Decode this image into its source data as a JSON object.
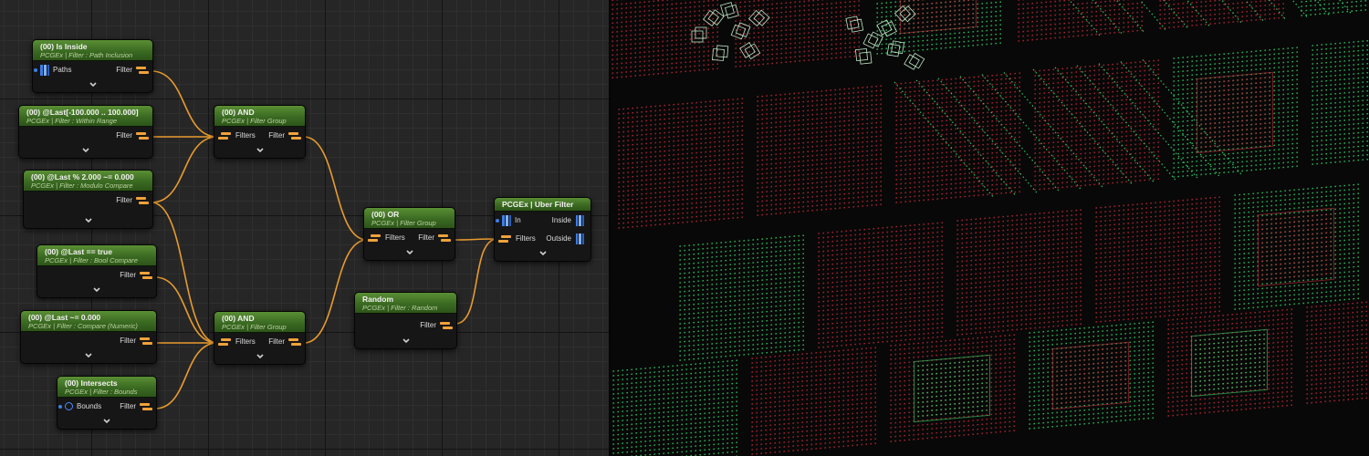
{
  "graph_editor": {
    "nodes": [
      {
        "id": "inside",
        "title": "(00) Is Inside",
        "subtitle": "PCGEx | Filter : Path Inclusion",
        "pins": [
          {
            "label": "Paths",
            "type": "points-in"
          },
          {
            "label": "Filter",
            "type": "filter-out"
          }
        ]
      },
      {
        "id": "range",
        "title": "(00) @Last[-100.000 .. 100.000]",
        "subtitle": "PCGEx | Filter : Within Range",
        "pins": [
          {
            "label": "Filter",
            "type": "filter-out"
          }
        ]
      },
      {
        "id": "modulo",
        "title": "(00) @Last % 2.000  ~=  0.000",
        "subtitle": "PCGEx | Filter : Modulo Compare",
        "pins": [
          {
            "label": "Filter",
            "type": "filter-out"
          }
        ]
      },
      {
        "id": "bool",
        "title": "(00) @Last == true",
        "subtitle": "PCGEx | Filter : Bool Compare",
        "pins": [
          {
            "label": "Filter",
            "type": "filter-out"
          }
        ]
      },
      {
        "id": "numeric",
        "title": "(00) @Last ~= 0.000",
        "subtitle": "PCGEx | Filter : Compare (Numeric)",
        "pins": [
          {
            "label": "Filter",
            "type": "filter-out"
          }
        ]
      },
      {
        "id": "bounds",
        "title": "(00) Intersects",
        "subtitle": "PCGEx | Filter : Bounds",
        "pins": [
          {
            "label": "Bounds",
            "type": "bounds-in"
          },
          {
            "label": "Filter",
            "type": "filter-out"
          }
        ]
      },
      {
        "id": "and1",
        "title": "(00) AND",
        "subtitle": "PCGEx | Filter Group",
        "pins": [
          {
            "label": "Filters",
            "label2": "Filter",
            "type": "group"
          }
        ]
      },
      {
        "id": "and2",
        "title": "(00) AND",
        "subtitle": "PCGEx | Filter Group",
        "pins": [
          {
            "label": "Filters",
            "label2": "Filter",
            "type": "group"
          }
        ]
      },
      {
        "id": "or",
        "title": "(00) OR",
        "subtitle": "PCGEx | Filter Group",
        "pins": [
          {
            "label": "Filters",
            "label2": "Filter",
            "type": "group"
          }
        ]
      },
      {
        "id": "random",
        "title": "Random",
        "subtitle": "PCGEx | Filter : Random",
        "pins": [
          {
            "label": "Filter",
            "type": "filter-out"
          }
        ]
      },
      {
        "id": "uber",
        "title": "PCGEx | Uber Filter",
        "subtitle": "",
        "pins": [
          {
            "label": "In",
            "label2": "Inside",
            "type": "uber-in"
          },
          {
            "label": "Filters",
            "label2": "Outside",
            "type": "uber-filters"
          }
        ]
      }
    ],
    "colors": {
      "header_green": "#4a7d2b",
      "wire_orange": "#e89b2e",
      "filter_pin": "#f0a23a",
      "points_pin": "#3d7de8",
      "point_inside": "#2fd86a",
      "point_outside": "#c8283a"
    },
    "icons": {
      "collapse": "chevron-down-icon",
      "points": "points-pin-icon",
      "bounds": "bounds-pin-icon",
      "filter": "filter-pin-icon"
    }
  },
  "viewport": {
    "description_colors": {
      "inside": "#2fd86a",
      "outside": "#c8283a"
    }
  }
}
